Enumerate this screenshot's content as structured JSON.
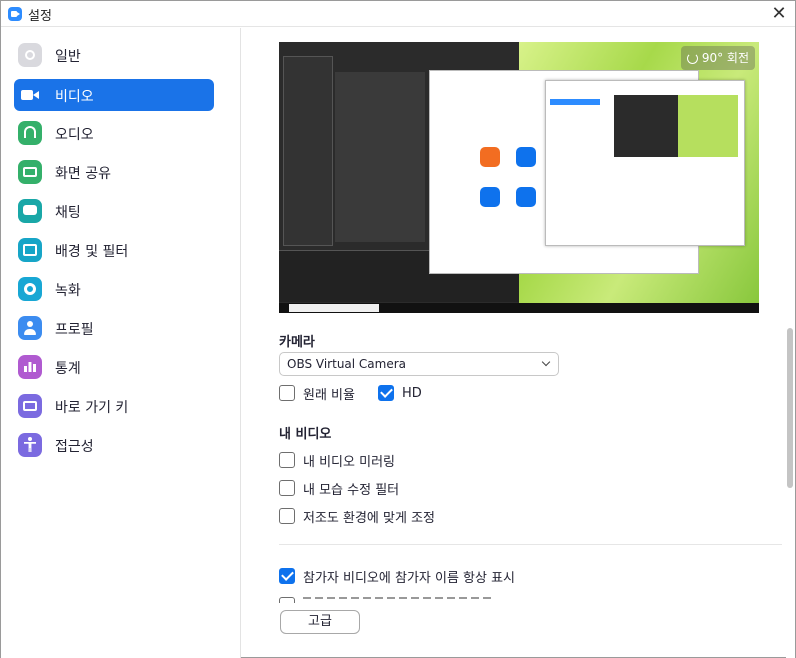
{
  "window": {
    "title": "설정"
  },
  "sidebar": {
    "items": [
      {
        "label": "일반",
        "icon": "gear-icon",
        "color": "#d9d9de",
        "active": false
      },
      {
        "label": "비디오",
        "icon": "video-camera-icon",
        "color": "#1a73e8",
        "active": true
      },
      {
        "label": "오디오",
        "icon": "headphones-icon",
        "color": "#34b06a",
        "active": false
      },
      {
        "label": "화면 공유",
        "icon": "screen-share-icon",
        "color": "#34b06a",
        "active": false
      },
      {
        "label": "채팅",
        "icon": "chat-bubble-icon",
        "color": "#19a7a7",
        "active": false
      },
      {
        "label": "배경 및 필터",
        "icon": "background-icon",
        "color": "#17a5c7",
        "active": false
      },
      {
        "label": "녹화",
        "icon": "record-icon",
        "color": "#18a7d4",
        "active": false
      },
      {
        "label": "프로필",
        "icon": "profile-icon",
        "color": "#3c8cf0",
        "active": false
      },
      {
        "label": "통계",
        "icon": "statistics-icon",
        "color": "#b05ad0",
        "active": false
      },
      {
        "label": "바로 가기 키",
        "icon": "keyboard-icon",
        "color": "#7b6ae0",
        "active": false
      },
      {
        "label": "접근성",
        "icon": "accessibility-icon",
        "color": "#7b6ae0",
        "active": false
      }
    ]
  },
  "video": {
    "rotate_label": "90° 회전",
    "camera_heading": "카메라",
    "camera_select": {
      "value": "OBS Virtual Camera"
    },
    "original_ratio": {
      "label": "원래 비율",
      "checked": false
    },
    "hd": {
      "label": "HD",
      "checked": true
    },
    "my_video_heading": "내 비디오",
    "mirror": {
      "label": "내 비디오 미러링",
      "checked": false
    },
    "touch_up": {
      "label": "내 모습 수정 필터",
      "checked": false
    },
    "low_light": {
      "label": "저조도 환경에 맞게 조정",
      "checked": false
    },
    "always_show_names": {
      "label": "참가자 비디오에 참가자 이름 항상 표시",
      "checked": true
    },
    "advanced_button": "고급"
  },
  "colors": {
    "accent": "#0e72ed",
    "active_nav": "#1a73e8"
  }
}
